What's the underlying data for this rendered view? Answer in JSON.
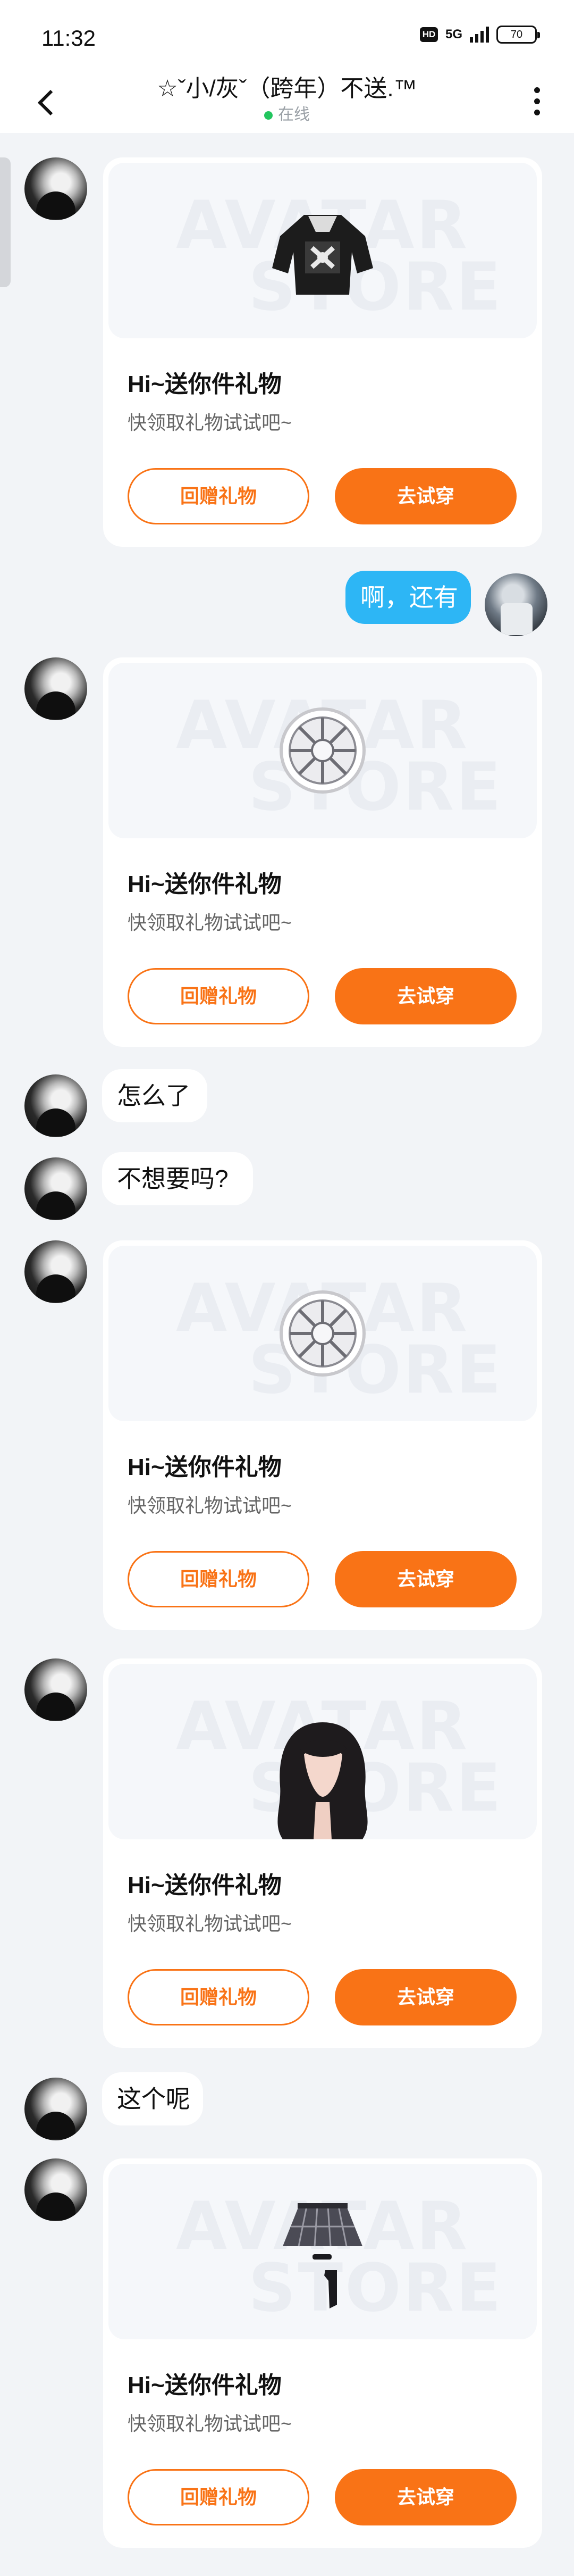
{
  "status_bar": {
    "time": "11:32",
    "hd": "HD",
    "network": "5G",
    "battery": "70"
  },
  "header": {
    "title": "☆ˇ小/灰ˇ（跨年）不送.™",
    "status": "在线"
  },
  "gift_card": {
    "title": "Hi~送你件礼物",
    "subtitle": "快领取礼物试试吧~",
    "return_label": "回赠礼物",
    "try_label": "去试穿",
    "watermark_1": "AVATAR",
    "watermark_2": "STORE"
  },
  "messages": {
    "m2": "啊，还有",
    "m4": "怎么了",
    "m5": "不想要吗?",
    "m8": "这个呢"
  },
  "colors": {
    "accent": "#f97316",
    "self_bubble": "#2db6f5",
    "online": "#22c55e"
  }
}
